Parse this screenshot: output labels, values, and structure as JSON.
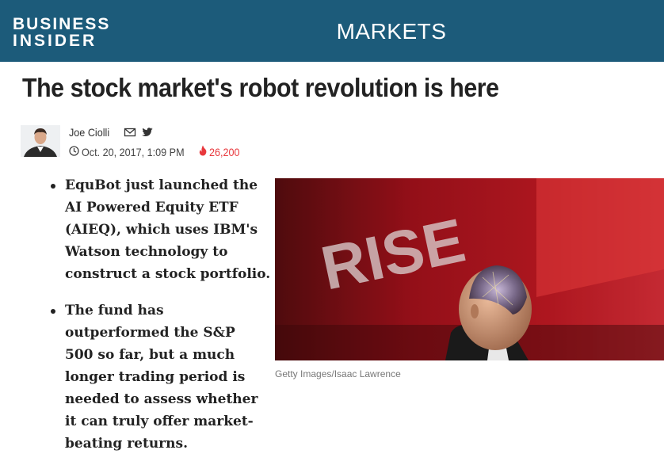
{
  "header": {
    "logo_line1": "BUSINESS",
    "logo_line2": "INSIDER",
    "section": "MARKETS",
    "background": "#1c5b7a"
  },
  "article": {
    "title": "The stock market's robot revolution is here",
    "author": "Joe Ciolli",
    "date": "Oct. 20, 2017, 1:09 PM",
    "views": "26,200",
    "bullets": [
      "EquBot just launched the AI Powered Equity ETF (AIEQ), which uses IBM's Watson technology to construct a stock portfolio.",
      "The fund has outperformed the S&P 500 so far, but a much longer trading period is needed to assess whether it can truly offer market-beating returns."
    ],
    "photo": {
      "sign_text": "RISE",
      "caption": "Getty Images/Isaac Lawrence"
    }
  },
  "icons": {
    "email": "email-icon",
    "twitter": "twitter-icon",
    "clock": "clock-icon",
    "flame": "flame-icon"
  },
  "colors": {
    "views": "#e8383d",
    "accent": "#1c5b7a"
  }
}
